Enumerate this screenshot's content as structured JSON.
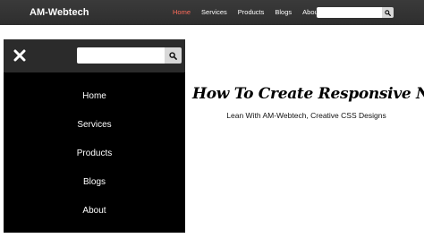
{
  "brand": "AM-Webtech",
  "topnav": {
    "items": [
      "Home",
      "Services",
      "Products",
      "Blogs",
      "About"
    ],
    "active_index": 0
  },
  "search": {
    "value": "",
    "icon": "search-icon"
  },
  "mobile_menu": {
    "close_icon": "close-icon",
    "search_value": "",
    "items": [
      "Home",
      "Services",
      "Products",
      "Blogs",
      "About"
    ]
  },
  "hero": {
    "title": "How To Create Responsive NavBar",
    "subtitle": "Lean With AM-Webtech, Creative CSS Designs"
  },
  "colors": {
    "navbar_bg": "#333333",
    "active_link": "#ff6b5a",
    "mobile_bg": "#000000",
    "mobile_header_bg": "#2b2b2b"
  }
}
